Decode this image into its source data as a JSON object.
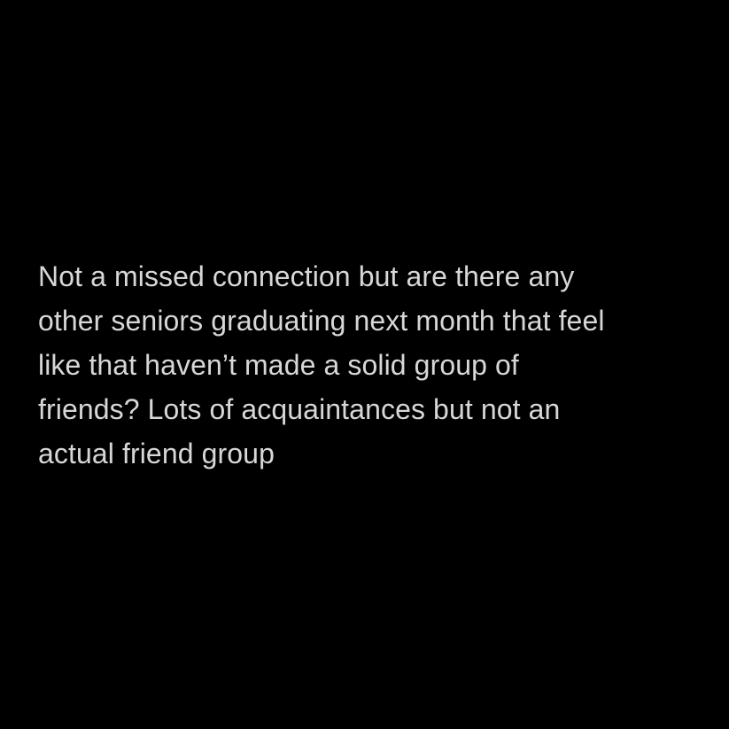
{
  "post": {
    "lines": [
      "Not a missed connection but are there any",
      "other seniors graduating next month that feel",
      "like that haven’t made a solid group of",
      "friends? Lots of acquaintances but not an",
      "actual friend group"
    ]
  },
  "colors": {
    "background": "#000000",
    "text": "#d7d7d7"
  }
}
